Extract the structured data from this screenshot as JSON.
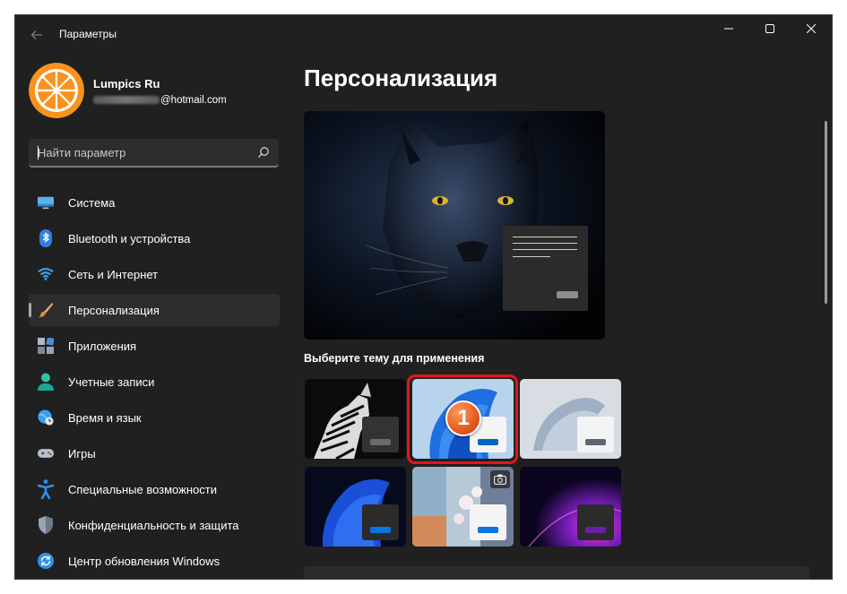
{
  "window": {
    "title": "Параметры",
    "controls": [
      "minimize",
      "maximize",
      "close"
    ]
  },
  "profile": {
    "name": "Lumpics Ru",
    "email_visible": "@hotmail.com"
  },
  "search": {
    "placeholder": "Найти параметр"
  },
  "sidebar": {
    "items": [
      {
        "label": "Система",
        "icon": "monitor-icon"
      },
      {
        "label": "Bluetooth и устройства",
        "icon": "bluetooth-icon"
      },
      {
        "label": "Сеть и Интернет",
        "icon": "wifi-icon"
      },
      {
        "label": "Персонализация",
        "icon": "brush-icon",
        "active": true
      },
      {
        "label": "Приложения",
        "icon": "apps-icon"
      },
      {
        "label": "Учетные записи",
        "icon": "person-icon"
      },
      {
        "label": "Время и язык",
        "icon": "clock-globe-icon"
      },
      {
        "label": "Игры",
        "icon": "gamepad-icon"
      },
      {
        "label": "Специальные возможности",
        "icon": "accessibility-icon"
      },
      {
        "label": "Конфиденциальность и защита",
        "icon": "shield-icon"
      },
      {
        "label": "Центр обновления Windows",
        "icon": "update-icon"
      }
    ]
  },
  "main": {
    "title": "Персонализация",
    "themes_label": "Выберите тему для применения",
    "themes": [
      {
        "name": "zebra-theme",
        "selected": false
      },
      {
        "name": "windows-light-bloom-theme",
        "selected": true
      },
      {
        "name": "silver-bloom-theme",
        "selected": false
      },
      {
        "name": "windows-dark-bloom-theme",
        "selected": false
      },
      {
        "name": "spotlight-flowers-theme",
        "selected": false
      },
      {
        "name": "purple-glow-theme",
        "selected": false
      }
    ],
    "step_badge": "1"
  },
  "colors": {
    "background": "#202020",
    "accent": "#0067c0",
    "highlight_frame": "#e5141a"
  }
}
